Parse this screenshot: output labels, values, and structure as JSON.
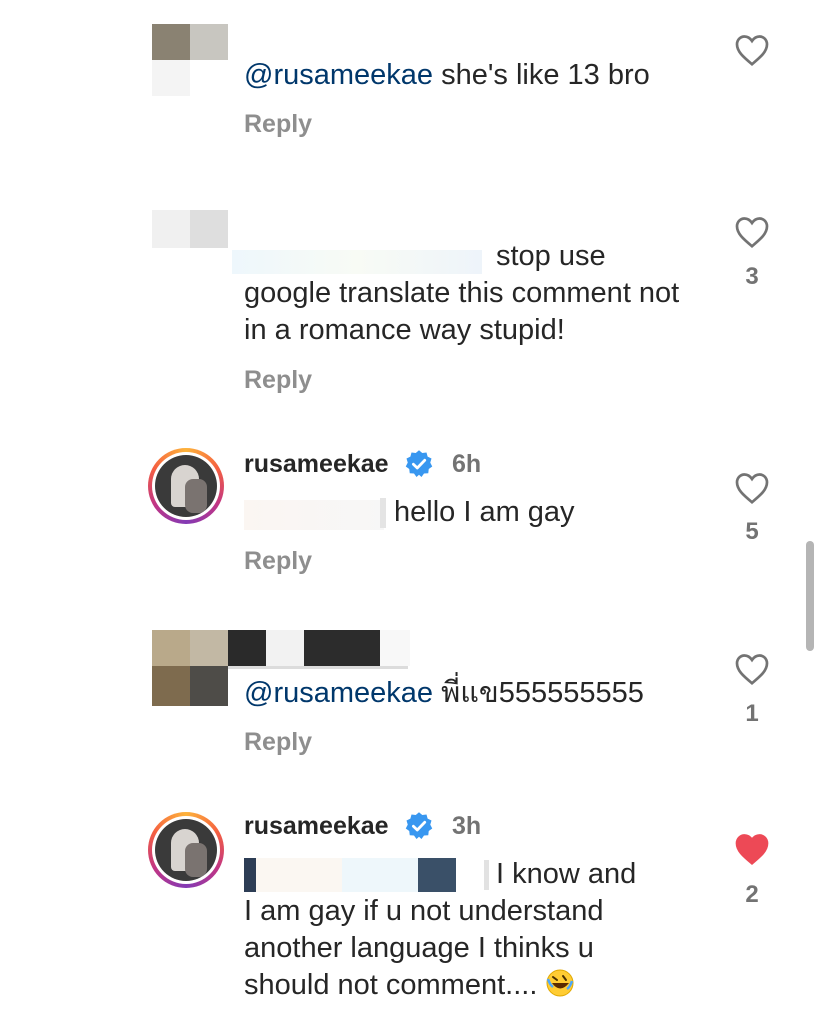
{
  "comments": [
    {
      "text_prefix": "@rusameekae",
      "text_body": " she's like 13 bro",
      "reply_label": "Reply",
      "likes": ""
    },
    {
      "text_body": "stop use google translate this comment not in a romance way stupid!",
      "reply_label": "Reply",
      "likes": "3"
    },
    {
      "username": "rusameekae",
      "time": "6h",
      "text_body": "hello I am gay",
      "reply_label": "Reply",
      "likes": "5"
    },
    {
      "text_prefix": "@rusameekae",
      "text_body": " พี่แข555555555",
      "reply_label": "Reply",
      "likes": "1"
    },
    {
      "username": "rusameekae",
      "time": "3h",
      "text_line1": "I know and",
      "text_line2": "I am gay if u not understand",
      "text_line3": "another language I thinks u",
      "text_line4": "should not comment....",
      "text_emoji": "🤣",
      "likes": "2"
    }
  ],
  "icons": {
    "like": "heart-outline-icon",
    "liked": "heart-filled-icon",
    "verified": "verified-badge-icon",
    "emoji": "rolling-on-floor-laughing"
  },
  "colors": {
    "mention": "#00376b",
    "liked": "#ed4956",
    "verified": "#3897f0",
    "muted": "#8e8e8e"
  }
}
